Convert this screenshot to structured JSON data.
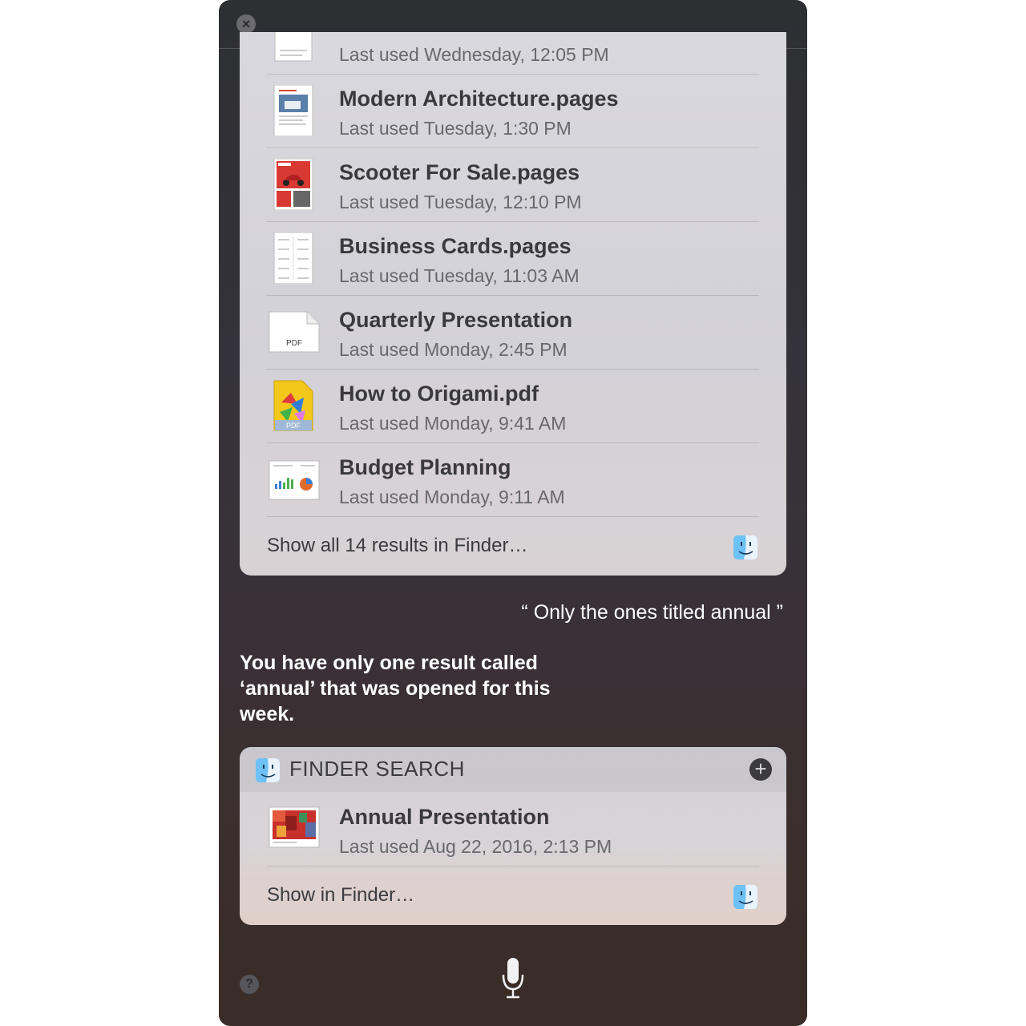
{
  "window": {
    "close_icon": "close-icon",
    "help_label": "?"
  },
  "results": {
    "partial_row": {
      "name": "",
      "date": "Last used Wednesday, 12:05 PM"
    },
    "rows": [
      {
        "name": "Modern Architecture.pages",
        "date": "Last used Tuesday, 1:30 PM",
        "icon": "pages-doc-thumbnail"
      },
      {
        "name": "Scooter For Sale.pages",
        "date": "Last used Tuesday, 12:10 PM",
        "icon": "pages-flyer-thumbnail"
      },
      {
        "name": "Business Cards.pages",
        "date": "Last used Tuesday, 11:03 AM",
        "icon": "pages-doc-thumbnail"
      },
      {
        "name": "Quarterly Presentation",
        "date": "Last used Monday, 2:45 PM",
        "icon": "pdf-file-icon",
        "icon_label": "PDF"
      },
      {
        "name": "How to Origami.pdf",
        "date": "Last used Monday, 9:41 AM",
        "icon": "pdf-colorful-thumbnail",
        "icon_label": "PDF"
      },
      {
        "name": "Budget Planning",
        "date": "Last used Monday, 9:11 AM",
        "icon": "numbers-chart-thumbnail"
      }
    ],
    "show_all": "Show all 14 results in Finder…"
  },
  "conversation": {
    "user_quote": "“ Only the ones titled annual ”",
    "siri_answer": "You have only one result called ‘annual’ that was opened for this week."
  },
  "finder_search": {
    "header": "FINDER SEARCH",
    "result": {
      "name": "Annual Presentation",
      "date": "Last used Aug 22, 2016, 2:13 PM",
      "icon": "keynote-thumbnail"
    },
    "show_in_finder": "Show in Finder…"
  },
  "colors": {
    "window_bg": "#2e2f33",
    "card_bg": "#d9d8de",
    "text_dark": "#3a3a3e",
    "text_muted": "#68686d"
  }
}
